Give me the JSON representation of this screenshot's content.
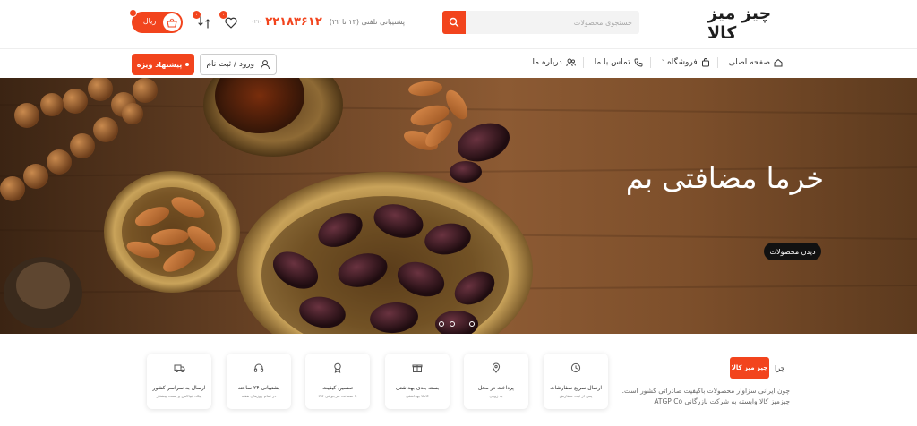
{
  "brand": {
    "logo_text": "چیز میز کالا"
  },
  "search": {
    "placeholder": "جستجوی محصولات"
  },
  "support": {
    "text": "پشتیبانی تلفنی (۱۳ تا ۲۲)",
    "phone": "۲۲۱۸۳۶۱۲",
    "code": "۰۲۱-"
  },
  "header_icons": {
    "wishlist_count": "۰",
    "compare_count": "۰"
  },
  "cart": {
    "label": "۰ ریال",
    "count": "۰"
  },
  "nav": {
    "items": [
      {
        "label": "صفحه اصلی"
      },
      {
        "label": "فروشگاه"
      },
      {
        "label": "تماس با ما"
      },
      {
        "label": "درباره ما"
      }
    ]
  },
  "account": {
    "login_label": "ورود / ثبت نام"
  },
  "special_offer": {
    "label": "پیشنهاد ویژه"
  },
  "hero": {
    "title": "خرما مضافتی بم",
    "cta": "دیدن محصولات"
  },
  "features": [
    {
      "title": "ارسال سریع سفارشات",
      "sub": "پس از ثبت سفارش"
    },
    {
      "title": "پرداخت در محل",
      "sub": "به زودی"
    },
    {
      "title": "بسته بندی بهداشتی",
      "sub": "کاملا بهداشتی"
    },
    {
      "title": "تضمین کیفیت",
      "sub": "با ضمانت مرجوعی کالا"
    },
    {
      "title": "پشتیبانی ۲۴ ساعته",
      "sub": "در تمام روزهای هفته"
    },
    {
      "title": "ارسال به سراسر کشور",
      "sub": "پیک، تیپاکس و پست پیشتاز"
    }
  ],
  "why": {
    "label": "چرا",
    "badge": "چیز میز کالا"
  },
  "about": {
    "text": "چون ایرانی سزاوار محصولات باکیفیت صادراتی کشور است. چیزمیز کالا وابسته به شرکت بازرگانی ATGP Co"
  },
  "colors": {
    "accent": "#f2441d",
    "dark": "#111111"
  }
}
